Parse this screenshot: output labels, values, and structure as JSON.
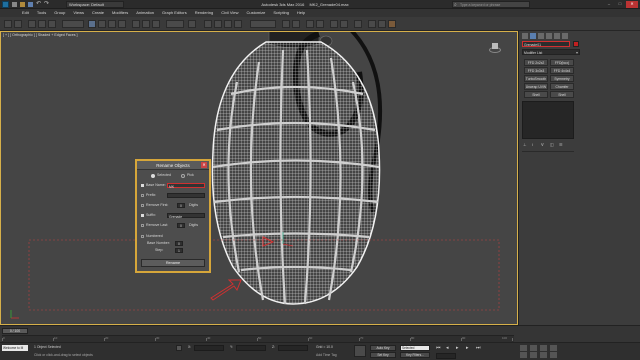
{
  "titlebar": {
    "workspace": "Workspace: Default",
    "app_title": "Autodesk 3ds Max 2016",
    "file_name": "MK2_Grenade04.max",
    "search_placeholder": "Type a keyword or phrase"
  },
  "menubar": {
    "items": [
      "Edit",
      "Tools",
      "Group",
      "Views",
      "Create",
      "Modifiers",
      "Animation",
      "Graph Editors",
      "Rendering",
      "Civil View",
      "Customize",
      "Scripting",
      "Help"
    ]
  },
  "viewport": {
    "label": "[ + ] [ Orthographic ] [ Shaded + Edged Faces ]"
  },
  "rename_dialog": {
    "title": "Rename Objects",
    "opt_selected": "Selected",
    "opt_pick": "Pick",
    "base_name_label": "Base Name:",
    "base_name_value": "MK",
    "prefix_label": "Prefix:",
    "remove_first_label": "Remove First:",
    "remove_first_value": "0",
    "digits_label": "Digits",
    "suffix_label": "Suffix:",
    "suffix_value": "Grenade",
    "remove_last_label": "Remove Last:",
    "remove_last_value": "0",
    "numbered_label": "Numbered",
    "base_number_label": "Base Number:",
    "base_number_value": "0",
    "step_label": "Step:",
    "step_value": "1",
    "rename_button": "Rename"
  },
  "command_panel": {
    "object_name": "Grenade01",
    "modifier_list": "Modifier List",
    "buttons": [
      "FFD 2x2x2",
      "FFD(box)",
      "FFD 3x3x3",
      "FFD 4x4x4",
      "TurboSmooth",
      "Symmetry",
      "Unwrap UVW",
      "Chamfer",
      "Shell",
      "Shell"
    ]
  },
  "timeline": {
    "frame_counter": "0 / 100",
    "ticks": [
      "0",
      "10",
      "20",
      "30",
      "40",
      "50",
      "60",
      "70",
      "80",
      "90",
      "100"
    ]
  },
  "statusbar": {
    "welcome": "Welcome to M",
    "selection_status": "1 Object Selected",
    "prompt": "Click or click-and-drag to select objects",
    "x_label": "X:",
    "y_label": "Y:",
    "z_label": "Z:",
    "grid": "Grid = 10.0",
    "auto_key": "Auto Key",
    "selected": "Selected",
    "set_key": "Set Key",
    "key_filters": "Key Filters...",
    "add_time_tag": "Add Time Tag"
  },
  "colors": {
    "accent": "#d6a63a",
    "highlight_red": "#d03030",
    "viewport_bg": "#454545"
  }
}
